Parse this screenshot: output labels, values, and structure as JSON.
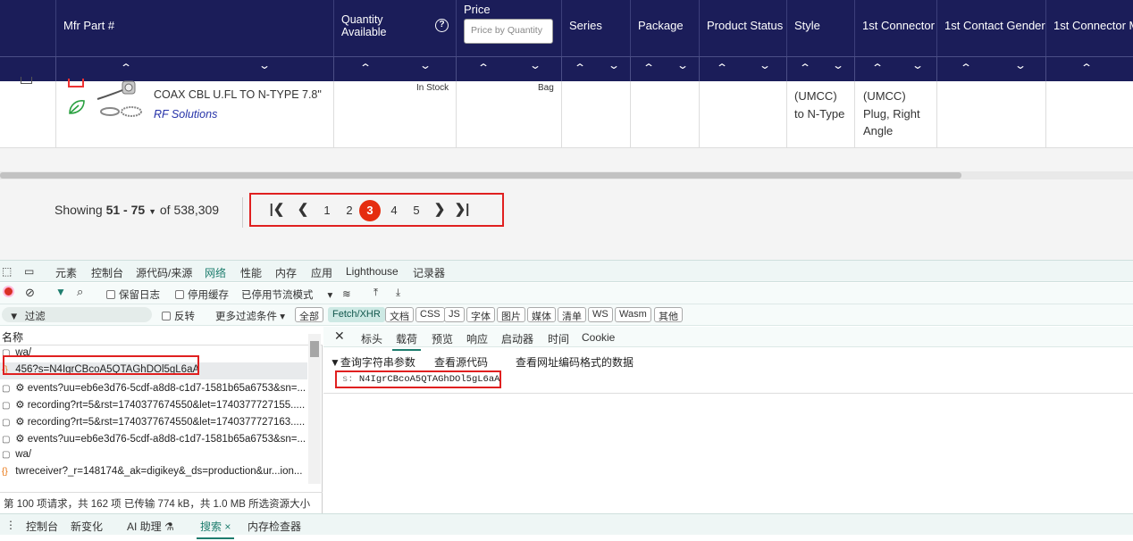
{
  "table": {
    "columns": {
      "mfr_part": "Mfr Part #",
      "quantity_line1": "Quantity",
      "quantity_line2": "Available",
      "price": "Price",
      "price_placeholder": "Price by Quantity",
      "series": "Series",
      "package": "Package",
      "product_status": "Product Status",
      "style": "Style",
      "connector1": "1st Connector",
      "contact_gender": "1st Contact Gender",
      "connector_mount": "1st Connector M"
    },
    "sort_up": "⌃",
    "sort_down": "⌄",
    "row": {
      "description": "COAX CBL U.FL TO N-TYPE 7.8\"",
      "manufacturer": "RF Solutions",
      "stock": "In Stock",
      "package": "Bag",
      "style_lines": [
        "(UMCC)",
        "to N-Type"
      ],
      "connector_lines": [
        "(UMCC)",
        "Plug, Right",
        "Angle"
      ]
    }
  },
  "pagination": {
    "showing_prefix": "Showing",
    "range": "51 - 75",
    "of_text": "of 538,309",
    "first": "|❮",
    "prev": "❮",
    "pages": [
      "1",
      "2",
      "3",
      "4",
      "5"
    ],
    "active_page": "3",
    "next": "❯",
    "last": "❯|"
  },
  "devtools": {
    "tabs": [
      "元素",
      "控制台",
      "源代码/来源",
      "网络",
      "性能",
      "内存",
      "应用",
      "Lighthouse",
      "记录器"
    ],
    "active_tab": "网络",
    "toolbar": {
      "preserve_log": "保留日志",
      "disable_cache": "停用缓存",
      "throttle": "已停用节流模式"
    },
    "filter": {
      "placeholder": "过滤",
      "invert": "反转",
      "more_filters": "更多过滤条件",
      "chips": [
        "全部",
        "Fetch/XHR",
        "文档",
        "CSS",
        "JS",
        "字体",
        "图片",
        "媒体",
        "清单",
        "WS",
        "Wasm",
        "其他"
      ],
      "active_chip": "Fetch/XHR"
    },
    "requests": {
      "header": "名称",
      "items": [
        "wa/",
        "456?s=N4IgrCBcoA5QTAGhDOl5gL6aA",
        "events?uu=eb6e3d76-5cdf-a8d8-c1d7-1581b65a6753&sn=...",
        "recording?rt=5&rst=1740377674550&let=1740377727155.....",
        "recording?rt=5&rst=1740377674550&let=1740377727163.....",
        "events?uu=eb6e3d76-5cdf-a8d8-c1d7-1581b65a6753&sn=...",
        "wa/",
        "twreceiver?_r=148174&_ak=digikey&_ds=production&ur...ion..."
      ],
      "status": "第 100 项请求，共 162 项   已传输 774 kB，共 1.0 MB   所选资源大小"
    },
    "detail": {
      "tabs": [
        "标头",
        "载荷",
        "预览",
        "响应",
        "启动器",
        "时间",
        "Cookie"
      ],
      "active_tab": "载荷",
      "section_title": "▼查询字符串参数",
      "view_source": "查看源代码",
      "view_url_encoded": "查看网址编码格式的数据",
      "param_key": "s:",
      "param_value": "N4IgrCBcoA5QTAGhDOl5gL6aA"
    },
    "drawer_tabs": [
      "控制台",
      "新变化",
      "AI 助理 ⚗",
      "搜索 ×",
      "内存检查器"
    ],
    "active_drawer_tab": "搜索 ×"
  }
}
